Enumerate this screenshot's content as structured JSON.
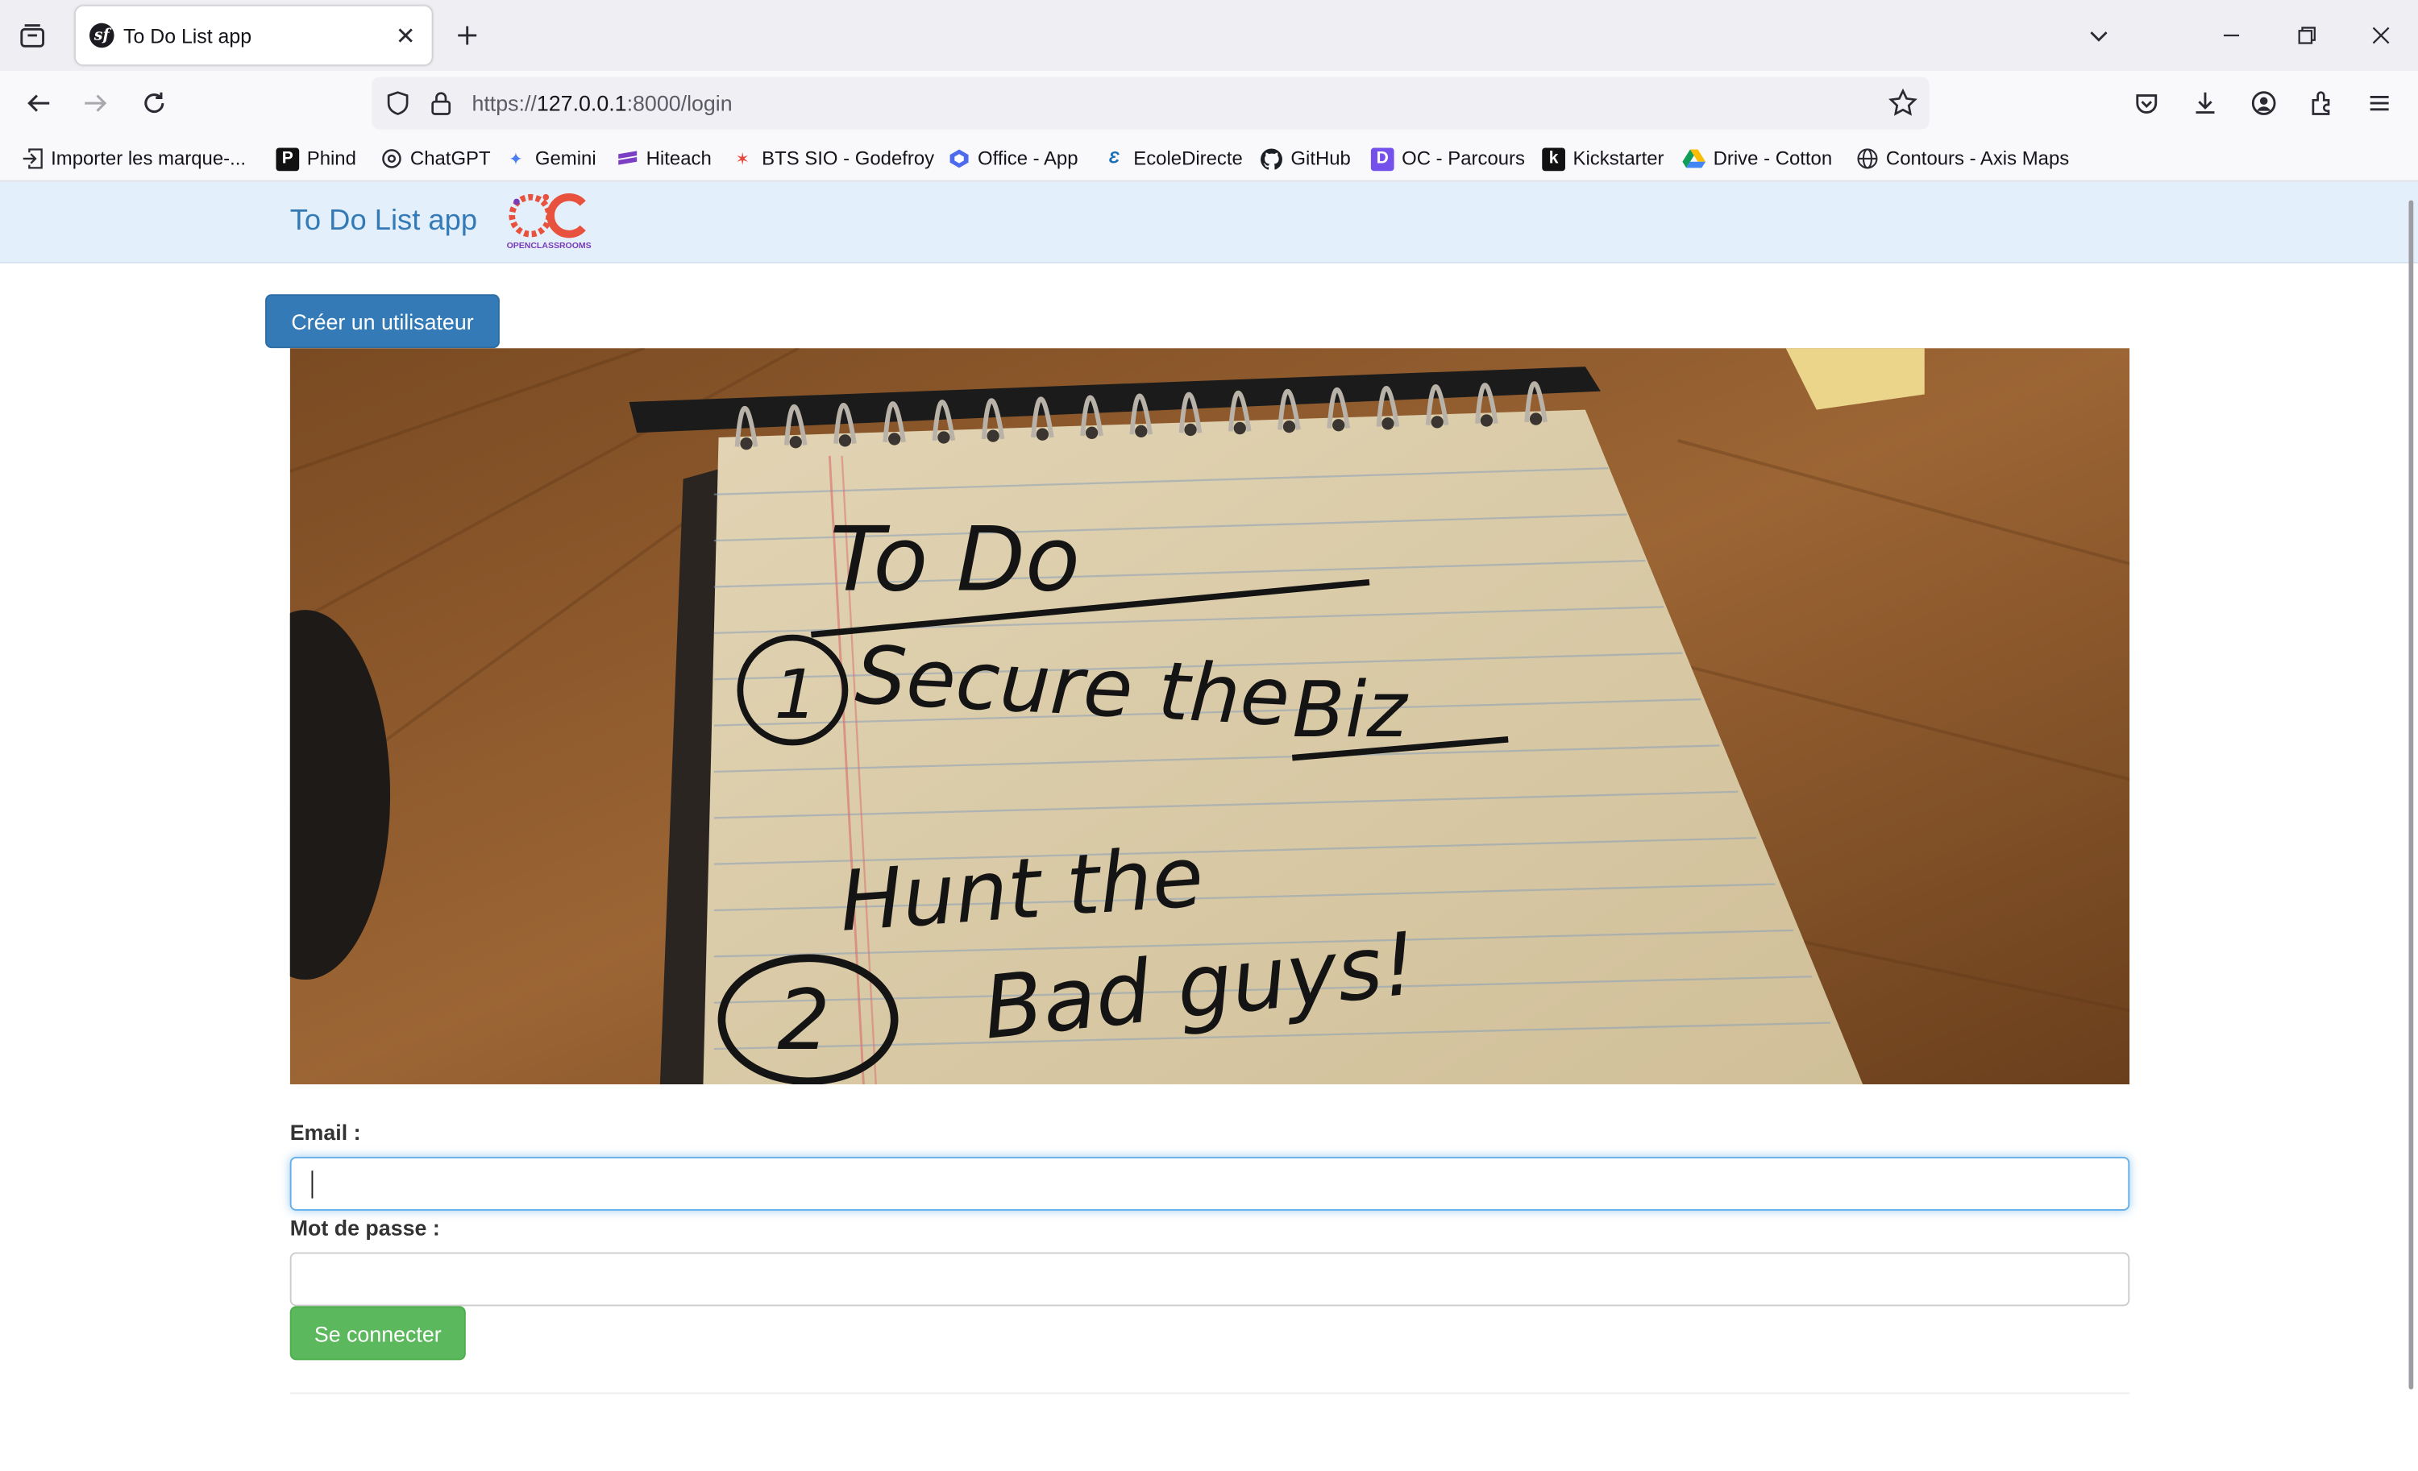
{
  "browser": {
    "tab": {
      "title": "To Do List app",
      "favicon": "symfony-icon"
    },
    "url": {
      "scheme": "https://",
      "host": "127.0.0.1",
      "rest": ":8000/login"
    },
    "bookmarks": [
      {
        "label": "Importer les marque-...",
        "icon": "import-icon"
      },
      {
        "label": "Phind",
        "icon": "phind-icon"
      },
      {
        "label": "ChatGPT",
        "icon": "chatgpt-icon"
      },
      {
        "label": "Gemini",
        "icon": "gemini-icon"
      },
      {
        "label": "Hiteach",
        "icon": "hiteach-icon"
      },
      {
        "label": "BTS SIO - Godefroy",
        "icon": "star-icon"
      },
      {
        "label": "Office - App",
        "icon": "office-icon"
      },
      {
        "label": "EcoleDirecte",
        "icon": "ecoledirecte-icon"
      },
      {
        "label": "GitHub",
        "icon": "github-icon"
      },
      {
        "label": "OC - Parcours",
        "icon": "openclassrooms-icon"
      },
      {
        "label": "Kickstarter",
        "icon": "kickstarter-icon"
      },
      {
        "label": "Drive - Cotton",
        "icon": "drive-icon"
      },
      {
        "label": "Contours - Axis Maps",
        "icon": "globe-icon"
      }
    ]
  },
  "site": {
    "brand": "To Do List app",
    "logo_text": "OPENCLASSROOMS",
    "create_user_label": "Créer un utilisateur",
    "hero": {
      "heading": "To Do",
      "line1": "Secure the",
      "line2": "Biz",
      "line3": "Hunt the",
      "line4": "Bad guys!",
      "num1": "1",
      "num2": "2"
    },
    "form": {
      "email_label": "Email :",
      "email_value": "",
      "password_label": "Mot de passe :",
      "password_value": "",
      "submit_label": "Se connecter"
    }
  },
  "colors": {
    "primary": "#337ab7",
    "success": "#5cb85c",
    "nav_bg": "#e3effb"
  }
}
